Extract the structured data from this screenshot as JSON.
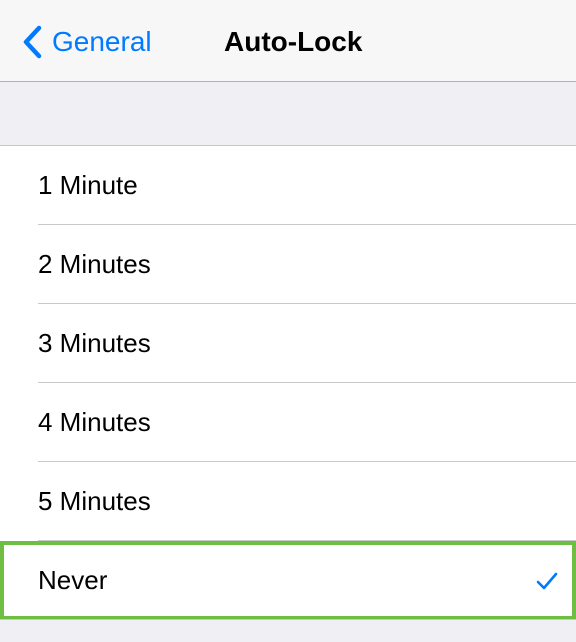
{
  "navbar": {
    "back_label": "General",
    "title": "Auto-Lock"
  },
  "options": [
    {
      "label": "1 Minute",
      "selected": false
    },
    {
      "label": "2 Minutes",
      "selected": false
    },
    {
      "label": "3 Minutes",
      "selected": false
    },
    {
      "label": "4 Minutes",
      "selected": false
    },
    {
      "label": "5 Minutes",
      "selected": false
    },
    {
      "label": "Never",
      "selected": true
    }
  ],
  "colors": {
    "accent": "#007aff",
    "highlight": "#6ebe44",
    "background": "#efeff4"
  },
  "icons": {
    "back": "chevron-left-icon",
    "selected": "checkmark-icon"
  }
}
